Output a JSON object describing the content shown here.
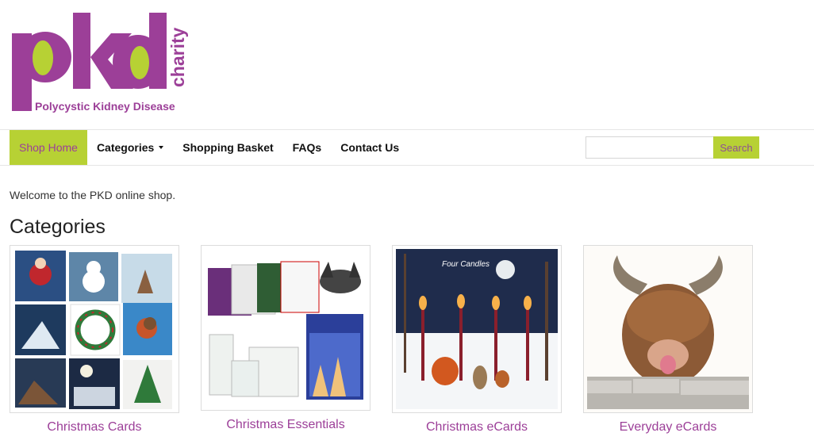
{
  "logo": {
    "brand": "pkd",
    "side_text": "charity",
    "tagline": "Polycystic Kidney Disease"
  },
  "nav": {
    "items": [
      {
        "label": "Shop Home",
        "active": true
      },
      {
        "label": "Categories",
        "dropdown": true
      },
      {
        "label": "Shopping Basket"
      },
      {
        "label": "FAQs"
      },
      {
        "label": "Contact Us"
      }
    ]
  },
  "search": {
    "value": "",
    "button_label": "Search"
  },
  "main": {
    "welcome": "Welcome to the PKD online shop.",
    "heading": "Categories",
    "categories": [
      {
        "label": "Christmas Cards"
      },
      {
        "label": "Christmas Essentials"
      },
      {
        "label": "Christmas eCards",
        "image_text": "Four Candles"
      },
      {
        "label": "Everyday eCards"
      }
    ]
  },
  "colors": {
    "brand_purple": "#9c3f98",
    "brand_green": "#b7d134"
  }
}
